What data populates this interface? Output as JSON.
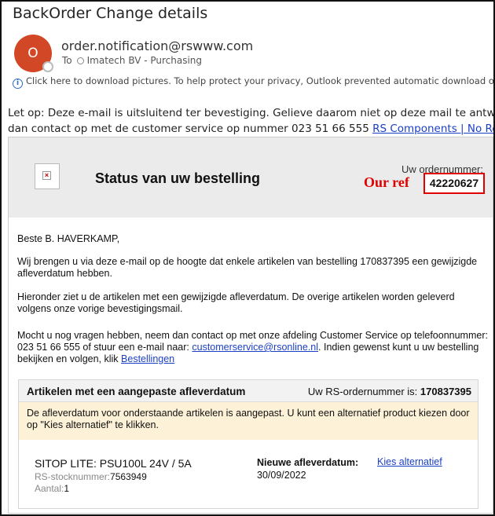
{
  "email": {
    "subject": "BackOrder Change details",
    "avatar_letter": "O",
    "sender": "order.notification@rswww.com",
    "to_prefix": "To",
    "recipient": "Imatech BV - Purchasing",
    "info_bar": "Click here to download pictures. To help protect your privacy, Outlook prevented automatic download of some pi",
    "notice_line1": "Let op: Deze e-mail is uitsluitend ter bevestiging. Gelieve daarom niet op deze mail te antwoorden, dez",
    "notice_line2_text": "dan contact op met de customer service op nummer 023 51 66 555 ",
    "notice_link": "RS Components | No Reply"
  },
  "message": {
    "status_title": "Status van uw bestelling",
    "ordernr_label": "Uw ordernummer:",
    "our_ref_label": "Our ref",
    "our_ref_value": "42220627",
    "greeting": "Beste B. HAVERKAMP,",
    "para1": "Wij brengen u via deze e-mail op de hoogte dat enkele artikelen van bestelling 170837395 een gewijzigde afleverdatum hebben.",
    "para2": "Hieronder ziet u de artikelen met een gewijzigde afleverdatum. De overige artikelen worden geleverd volgens onze vorige bevestigingsmail.",
    "para3_a": "Mocht u nog vragen hebben, neem dan contact op met onze afdeling Customer Service op telefoonnummer: 023 51 66 555 of stuur een e-mail naar: ",
    "para3_email": "customerservice@rsonline.nl",
    "para3_b": ". Indien gewenst kunt u uw bestelling bekijken en volgen, klik ",
    "para3_link": "Bestellingen"
  },
  "articles": {
    "title": "Artikelen met een aangepaste afleverdatum",
    "rs_order_label": "Uw RS-ordernummer is:",
    "rs_order_value": "170837395",
    "warning": "De afleverdatum voor onderstaande artikelen is aangepast. U kunt een alternatief product kiezen door op \"Kies alternatief\" te klikken.",
    "item": {
      "name": "SITOP LITE: PSU100L 24V / 5A",
      "stock_label": "RS-stocknummer:",
      "stock_value": "7563949",
      "qty_label": "Aantal:",
      "qty_value": "1",
      "new_date_label": "Nieuwe afleverdatum:",
      "new_date_value": "30/09/2022",
      "alt_link": "Kies alternatief"
    }
  },
  "colors": {
    "avatar": "#d24726",
    "link": "#1a3fc4",
    "highlight": "#e00000",
    "warning_band": "#fdf2d8"
  }
}
